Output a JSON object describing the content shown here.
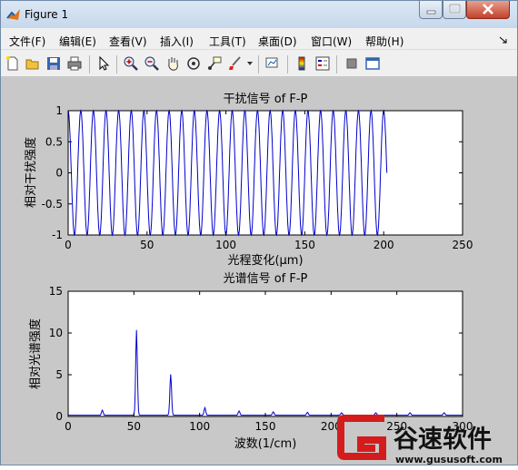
{
  "window": {
    "title": "Figure 1"
  },
  "menu": [
    "文件(F)",
    "编辑(E)",
    "查看(V)",
    "插入(I)",
    "工具(T)",
    "桌面(D)",
    "窗口(W)",
    "帮助(H)"
  ],
  "toolbar_icons": [
    "new-file-icon",
    "open-folder-icon",
    "save-icon",
    "print-icon",
    "pointer-icon",
    "zoom-in-icon",
    "zoom-out-icon",
    "pan-hand-icon",
    "rotate-3d-icon",
    "data-cursor-icon",
    "brush-icon",
    "brush-dropdown-icon",
    "link-plot-icon",
    "colorbar-icon",
    "legend-icon",
    "hide-plot-tools-icon",
    "show-plot-tools-icon"
  ],
  "watermark": {
    "brand": "谷速软件",
    "url": "www.gususoft.com"
  },
  "chart_data": [
    {
      "type": "line",
      "title": "干扰信号 of F-P",
      "xlabel": "光程变化(μm)",
      "ylabel": "相对干扰强度",
      "xlim": [
        0,
        250
      ],
      "ylim": [
        -1,
        1
      ],
      "xticks": [
        0,
        50,
        100,
        150,
        200,
        250
      ],
      "yticks": [
        -1,
        -0.5,
        0,
        0.5,
        1
      ],
      "xtick_labels": [
        "0",
        "50",
        "100",
        "150",
        "200",
        "250"
      ],
      "ytick_labels": [
        "-1",
        "-0.5",
        "0",
        "0.5",
        "1"
      ],
      "series": [
        {
          "color": "#0000cc",
          "signal": "cosine",
          "period_um": 8,
          "x_start": 0,
          "x_end": 202
        }
      ],
      "grid": false
    },
    {
      "type": "line",
      "title": "光谱信号 of F-P",
      "xlabel": "波数(1/cm)",
      "ylabel": "相对光谱强度",
      "xlim": [
        0,
        300
      ],
      "ylim": [
        0,
        15
      ],
      "xticks": [
        0,
        50,
        100,
        150,
        200,
        250,
        300
      ],
      "yticks": [
        0,
        5,
        10,
        15
      ],
      "xtick_labels": [
        "0",
        "50",
        "100",
        "150",
        "200",
        "250",
        "300"
      ],
      "ytick_labels": [
        "0",
        "5",
        "10",
        "15"
      ],
      "series": [
        {
          "color": "#0000cc",
          "peaks": [
            [
              26,
              0.6
            ],
            [
              52,
              10.2
            ],
            [
              78,
              4.9
            ],
            [
              104,
              0.9
            ],
            [
              130,
              0.5
            ],
            [
              156,
              0.4
            ],
            [
              182,
              0.35
            ],
            [
              208,
              0.3
            ],
            [
              234,
              0.3
            ],
            [
              260,
              0.3
            ],
            [
              286,
              0.3
            ]
          ]
        }
      ],
      "grid": false
    }
  ]
}
